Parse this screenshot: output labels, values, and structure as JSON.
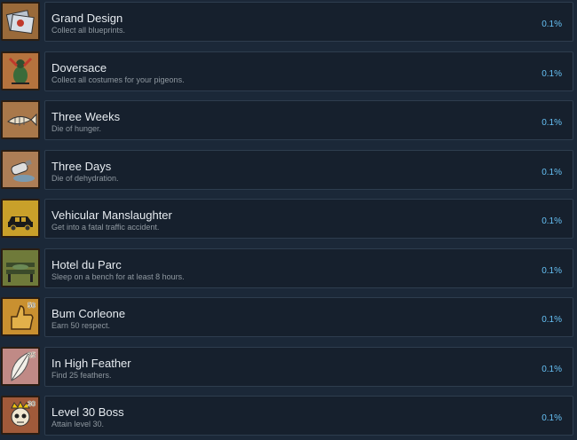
{
  "achievements": [
    {
      "title": "Grand Design",
      "description": "Collect all blueprints.",
      "percent": "0.1%",
      "icon": "blueprints-icon",
      "bg": "#9a6a3a"
    },
    {
      "title": "Doversace",
      "description": "Collect all costumes for your pigeons.",
      "percent": "0.1%",
      "icon": "pigeon-costume-icon",
      "bg": "#b5733e"
    },
    {
      "title": "Three Weeks",
      "description": "Die of hunger.",
      "percent": "0.1%",
      "icon": "fish-skeleton-icon",
      "bg": "#a9784a"
    },
    {
      "title": "Three Days",
      "description": "Die of dehydration.",
      "percent": "0.1%",
      "icon": "spilled-bottle-icon",
      "bg": "#ad7e56"
    },
    {
      "title": "Vehicular Manslaughter",
      "description": "Get into a fatal traffic accident.",
      "percent": "0.1%",
      "icon": "car-icon",
      "bg": "#c9a02a"
    },
    {
      "title": "Hotel du Parc",
      "description": "Sleep on a bench for at least 8 hours.",
      "percent": "0.1%",
      "icon": "bench-icon",
      "bg": "#6f7a3a"
    },
    {
      "title": "Bum Corleone",
      "description": "Earn 50 respect.",
      "percent": "0.1%",
      "icon": "thumbs-up-icon",
      "bg": "#c99030",
      "badge": "50"
    },
    {
      "title": "In High Feather",
      "description": "Find 25 feathers.",
      "percent": "0.1%",
      "icon": "feather-icon",
      "bg": "#c08a86",
      "badge": "25"
    },
    {
      "title": "Level 30 Boss",
      "description": "Attain level 30.",
      "percent": "0.1%",
      "icon": "crowned-skull-icon",
      "bg": "#a05a3a",
      "badge": "30"
    }
  ]
}
